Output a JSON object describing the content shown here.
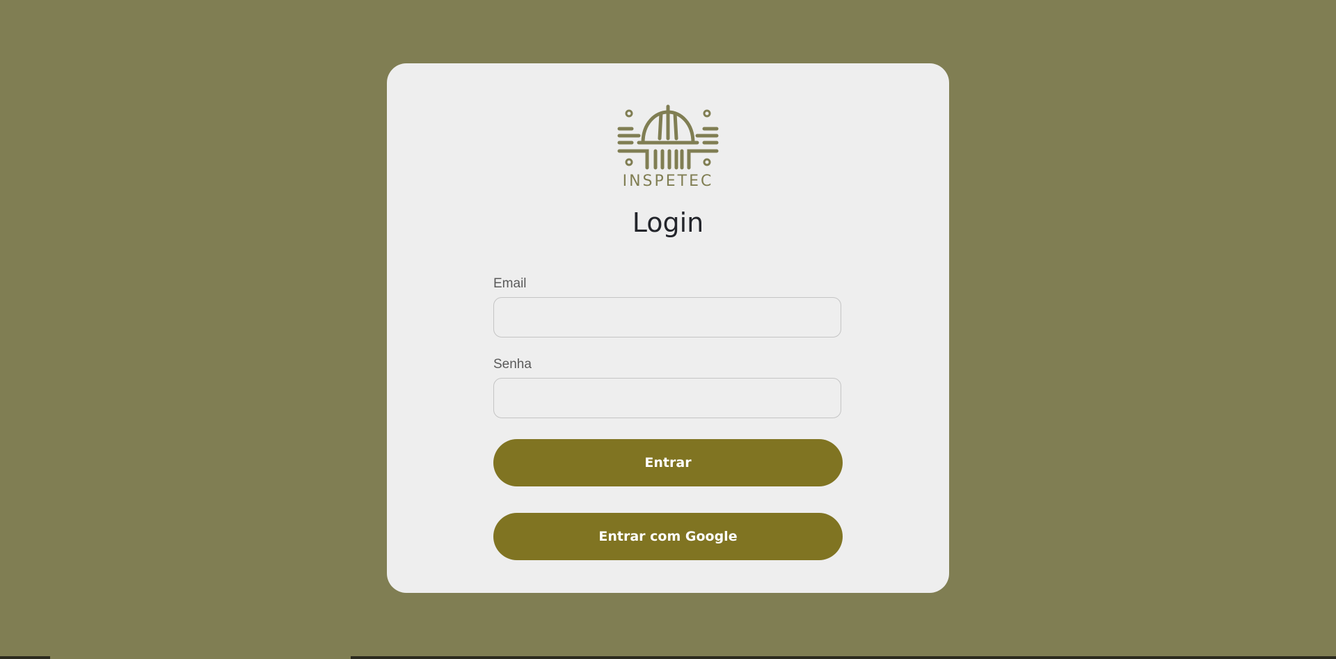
{
  "brand": {
    "name": "INSPETEC",
    "logo_icon": "hardhat-circuit-logo-icon",
    "color": "#807e53"
  },
  "login": {
    "title": "Login",
    "email_label": "Email",
    "email_value": "",
    "password_label": "Senha",
    "password_value": "",
    "submit_label": "Entrar",
    "google_label": "Entrar com Google"
  },
  "theme": {
    "background": "#807e53",
    "card": "#eeeeee",
    "button": "#807422"
  }
}
